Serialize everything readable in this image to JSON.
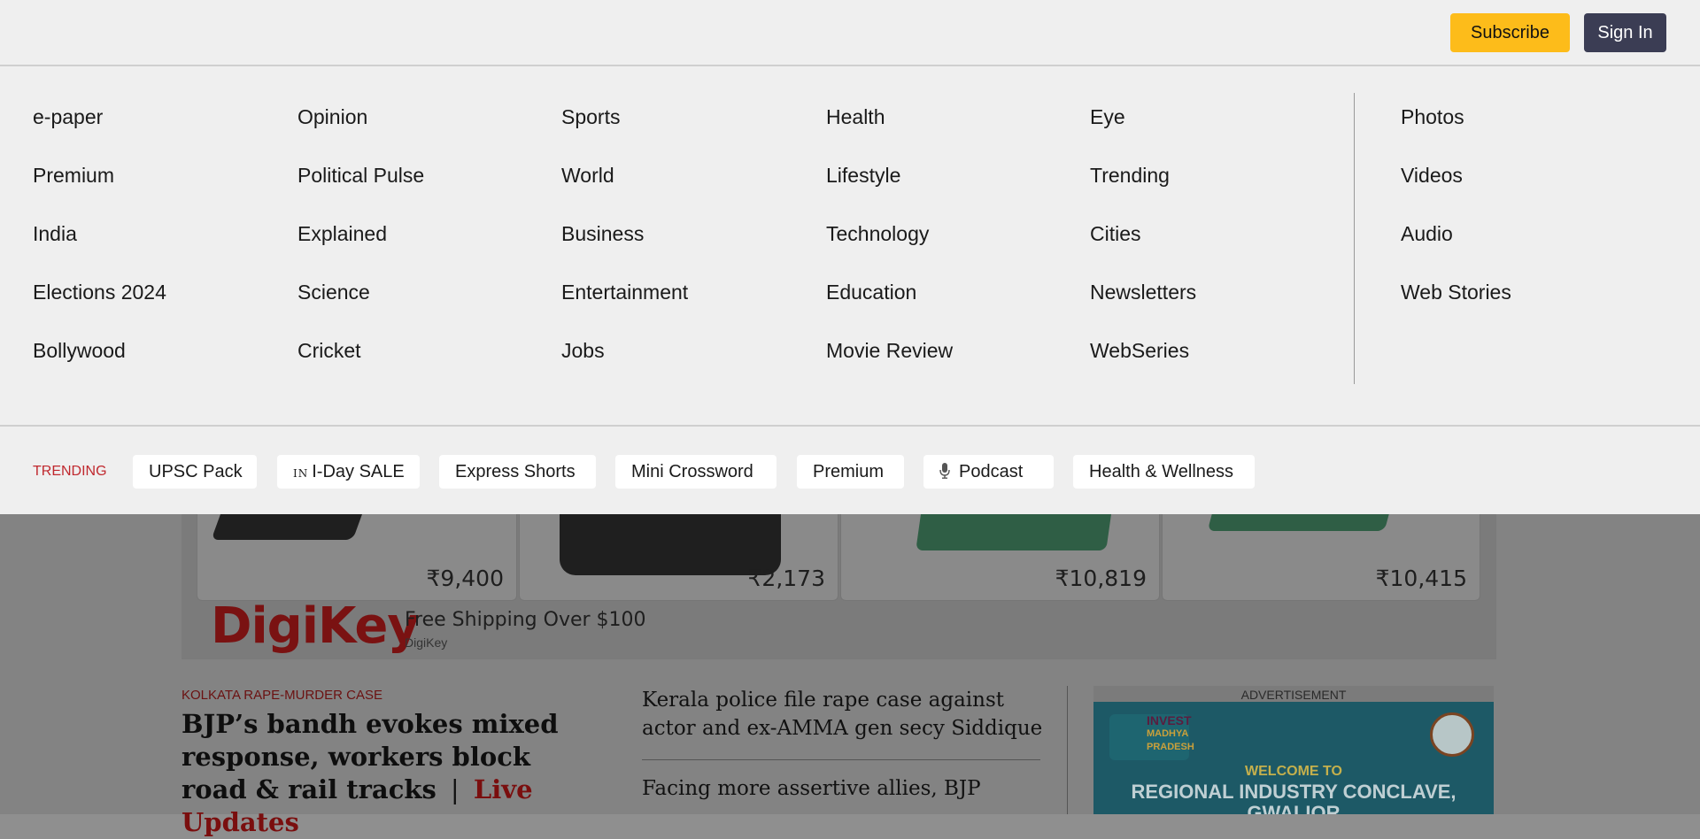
{
  "header": {
    "subscribe_label": "Subscribe",
    "signin_label": "Sign In"
  },
  "menu": {
    "columns": [
      [
        "e-paper",
        "Premium",
        "India",
        "Elections 2024",
        "Bollywood"
      ],
      [
        "Opinion",
        "Political Pulse",
        "Explained",
        "Science",
        "Cricket"
      ],
      [
        "Sports",
        "World",
        "Business",
        "Entertainment",
        "Jobs"
      ],
      [
        "Health",
        "Lifestyle",
        "Technology",
        "Education",
        "Movie Review"
      ],
      [
        "Eye",
        "Trending",
        "Cities",
        "Newsletters",
        "WebSeries"
      ],
      [
        "Photos",
        "Videos",
        "Audio",
        "Web Stories"
      ]
    ]
  },
  "trending": {
    "label": "TRENDING",
    "items": [
      {
        "label": "UPSC Pack"
      },
      {
        "prefix": "IN",
        "label": "I-Day SALE"
      },
      {
        "label": "Express Shorts"
      },
      {
        "label": "Mini Crossword"
      },
      {
        "label": "Premium"
      },
      {
        "icon": "microphone-icon",
        "label": "Podcast"
      },
      {
        "label": "Health & Wellness"
      }
    ]
  },
  "ad": {
    "prices": [
      "₹9,400",
      "₹2,173",
      "₹10,819",
      "₹10,415"
    ],
    "brand": "DigiKey",
    "tagline": "Free Shipping Over $100",
    "sub": "DigiKey"
  },
  "story": {
    "kicker": "KOLKATA RAPE-MURDER CASE",
    "headline": "BJP’s bandh evokes mixed response, workers block road & rail tracks",
    "separator": "|",
    "live": "Live Updates"
  },
  "side_stories": [
    "Kerala police file rape case against actor and ex-AMMA gen secy Siddique",
    "Facing more assertive allies, BJP"
  ],
  "advertisement": {
    "label": "ADVERTISEMENT",
    "logo_text": [
      "INVEST",
      "MADHYA",
      "PRADESH"
    ],
    "welcome": "WELCOME TO",
    "title": "REGIONAL INDUSTRY CONCLAVE, GWALIOR"
  }
}
